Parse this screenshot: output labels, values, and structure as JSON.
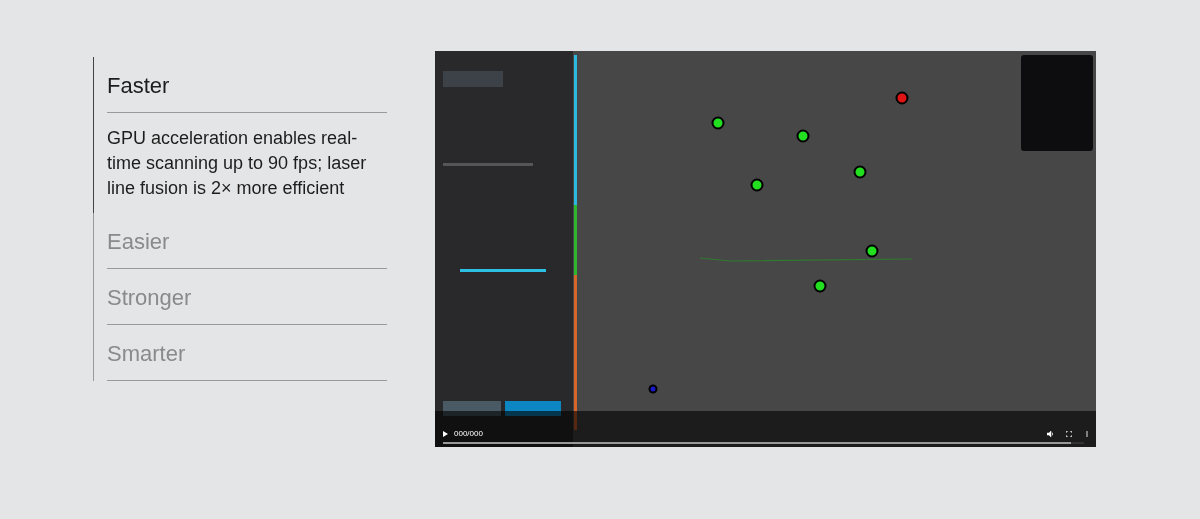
{
  "features": [
    {
      "title": "Faster",
      "expanded": true,
      "description": "GPU acceleration enables real-time scanning up to 90 fps; laser line fusion is 2× more efficient"
    },
    {
      "title": "Easier",
      "expanded": false
    },
    {
      "title": "Stronger",
      "expanded": false
    },
    {
      "title": "Smarter",
      "expanded": false
    }
  ],
  "video": {
    "kind": "picture",
    "time": "000/000",
    "progress": {
      "level": 0.98
    }
  }
}
